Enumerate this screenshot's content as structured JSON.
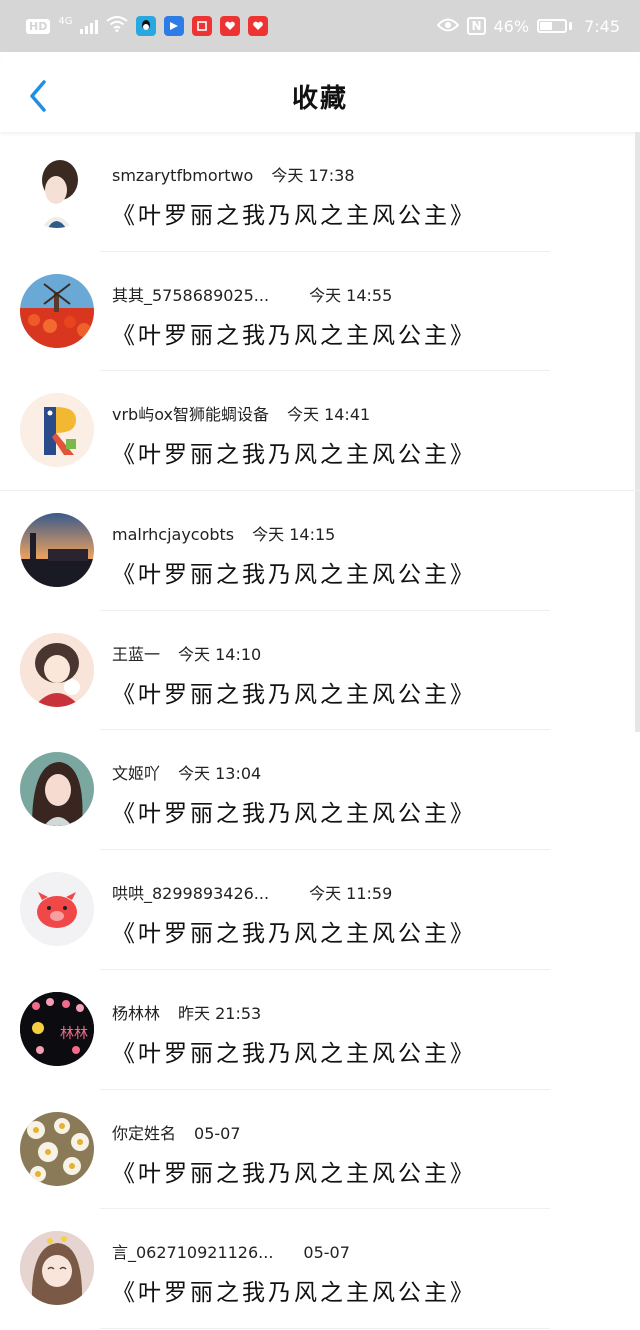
{
  "status_bar": {
    "hd": "HD",
    "network": "4G",
    "nfc": "N",
    "battery": "46%",
    "time": "7:45"
  },
  "header": {
    "title": "收藏"
  },
  "favorites": [
    {
      "user": "smzarytfbmortwo",
      "time": "今天 17:38",
      "book": "《叶罗丽之我乃风之主风公主》"
    },
    {
      "user": "其其_5758689025...",
      "time": "今天 14:55",
      "book": "《叶罗丽之我乃风之主风公主》"
    },
    {
      "user": "vrb屿ox智狮能蜩设备",
      "time": "今天 14:41",
      "book": "《叶罗丽之我乃风之主风公主》"
    },
    {
      "user": "malrhcjaycobts",
      "time": "今天 14:15",
      "book": "《叶罗丽之我乃风之主风公主》"
    },
    {
      "user": "王蓝一",
      "time": "今天 14:10",
      "book": "《叶罗丽之我乃风之主风公主》"
    },
    {
      "user": "文姬吖",
      "time": "今天 13:04",
      "book": "《叶罗丽之我乃风之主风公主》"
    },
    {
      "user": "哄哄_8299893426...",
      "time": "今天 11:59",
      "book": "《叶罗丽之我乃风之主风公主》"
    },
    {
      "user": "杨林林",
      "time": "昨天 21:53",
      "book": "《叶罗丽之我乃风之主风公主》"
    },
    {
      "user": "你定姓名",
      "time": "05-07",
      "book": "《叶罗丽之我乃风之主风公主》"
    },
    {
      "user": "言_062710921126...",
      "time": "05-07",
      "book": "《叶罗丽之我乃风之主风公主》"
    }
  ],
  "avatar_lettering": {
    "r_logo": "R",
    "black_avatar": "林林"
  },
  "colors": {
    "accent": "#1f8fe6",
    "status_bar": "#d6d6d6"
  }
}
